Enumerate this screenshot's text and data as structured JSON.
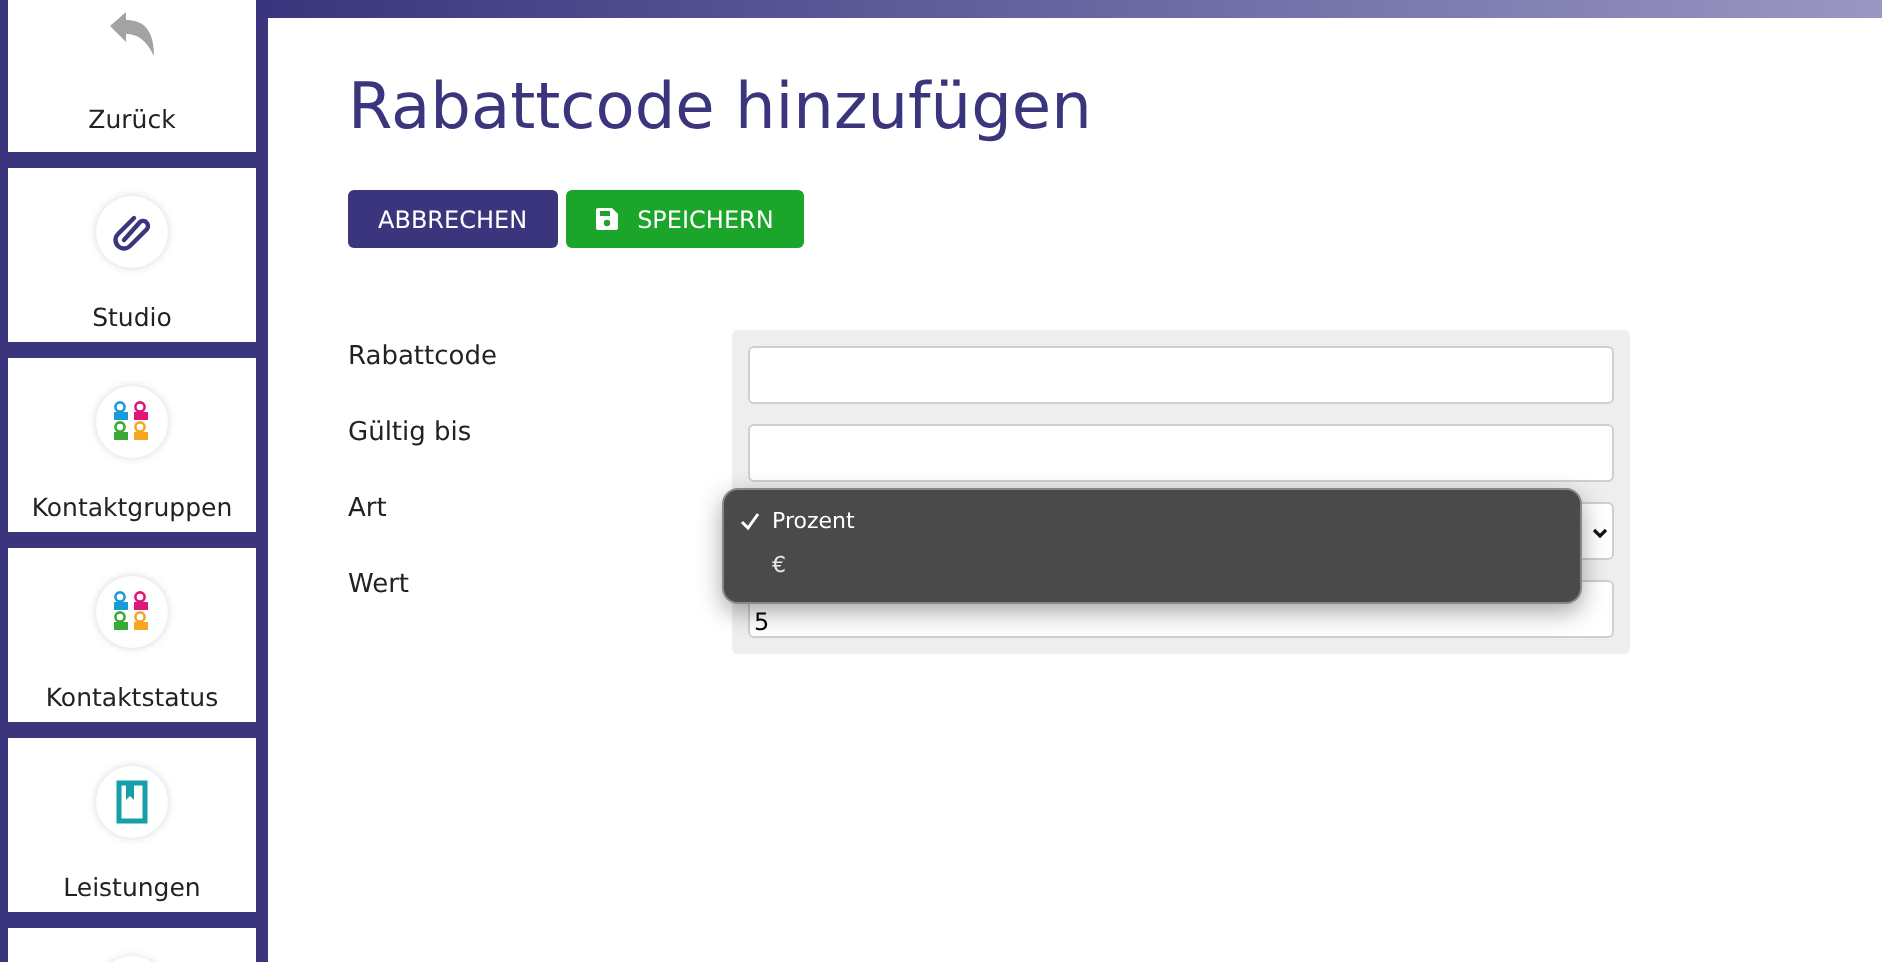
{
  "sidebar": {
    "items": [
      {
        "label": "Zurück",
        "kind": "back"
      },
      {
        "label": "Studio",
        "kind": "clip"
      },
      {
        "label": "Kontaktgruppen",
        "kind": "people"
      },
      {
        "label": "Kontaktstatus",
        "kind": "people"
      },
      {
        "label": "Leistungen",
        "kind": "book"
      },
      {
        "kind": "partial"
      }
    ]
  },
  "page": {
    "title": "Rabattcode hinzufügen",
    "buttons": [
      {
        "label": "ABBRECHEN",
        "kind": "cancel"
      },
      {
        "label": "SPEICHERN",
        "kind": "save"
      }
    ],
    "fields": [
      {
        "label": "Rabattcode",
        "kind": "text"
      },
      {
        "label": "Gültig bis",
        "kind": "text"
      },
      {
        "label": "Art",
        "kind": "select",
        "expanded": true,
        "options": [
          {
            "label": "Prozent",
            "selected": true
          },
          {
            "label": "€",
            "selected": false
          }
        ]
      },
      {
        "label": "Wert",
        "kind": "text",
        "value": "5"
      }
    ]
  }
}
